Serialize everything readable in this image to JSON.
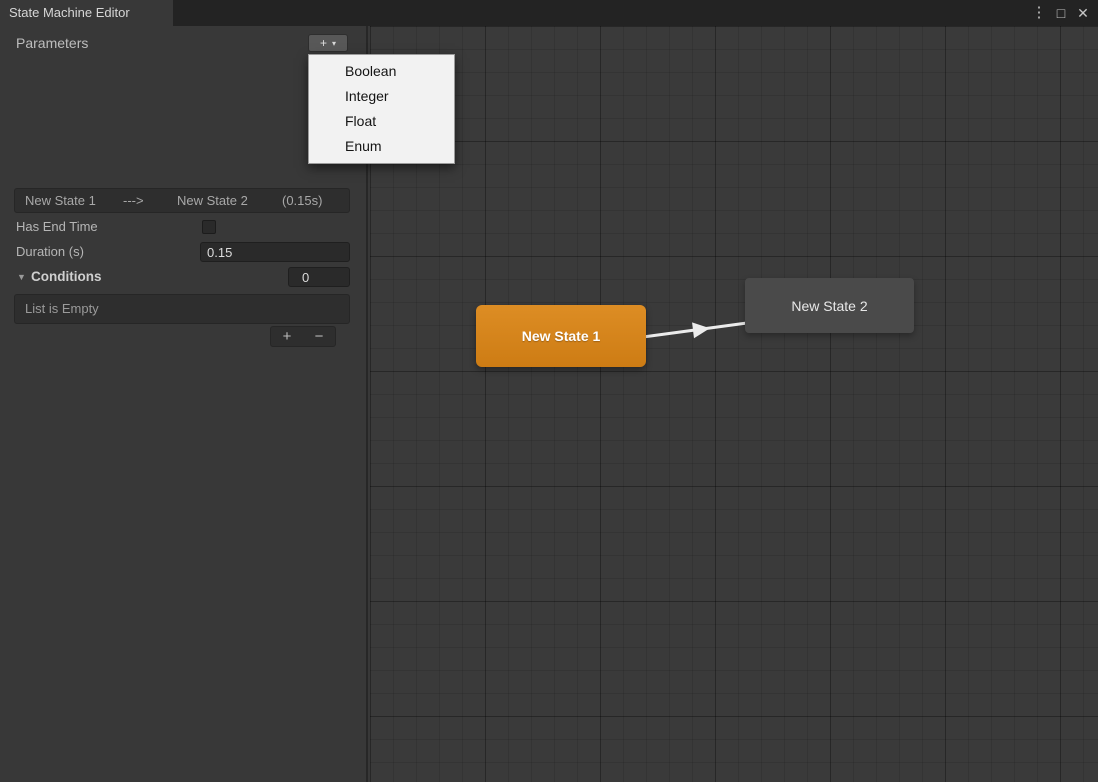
{
  "window": {
    "tab_title": "State Machine Editor",
    "menu_icon": "⋮",
    "maximize_icon": "□",
    "close_icon": "✕"
  },
  "parameters": {
    "label": "Parameters",
    "add_button": {
      "plus": "+",
      "caret": "▾"
    },
    "dropdown_items": [
      "Boolean",
      "Integer",
      "Float",
      "Enum"
    ]
  },
  "inspector": {
    "header": {
      "from": "New State 1",
      "arrow": "--->",
      "to": "New State 2",
      "duration": "(0.15s)"
    },
    "has_end_time_label": "Has End Time",
    "has_end_time_checked": false,
    "duration_label": "Duration (s)",
    "duration_value": "0.15",
    "conditions": {
      "foldout_icon": "▼",
      "label": "Conditions",
      "count": "0"
    },
    "empty_list_text": "List is Empty",
    "footer": {
      "add": "+",
      "remove": "−"
    }
  },
  "canvas": {
    "nodes": [
      {
        "label": "New State 1",
        "color": "#d8861d",
        "selected": true
      },
      {
        "label": "New State 2",
        "color": "#4a4a4a",
        "selected": false
      }
    ],
    "transition": {
      "from": "New State 1",
      "to": "New State 2"
    }
  },
  "colors": {
    "background": "#383838",
    "titlebar": "#232323",
    "field": "#2a2a2a",
    "dropdown_bg": "#f2f2f2",
    "selected_node": "#d8861d",
    "node": "#4a4a4a",
    "arrow": "#ececec"
  }
}
